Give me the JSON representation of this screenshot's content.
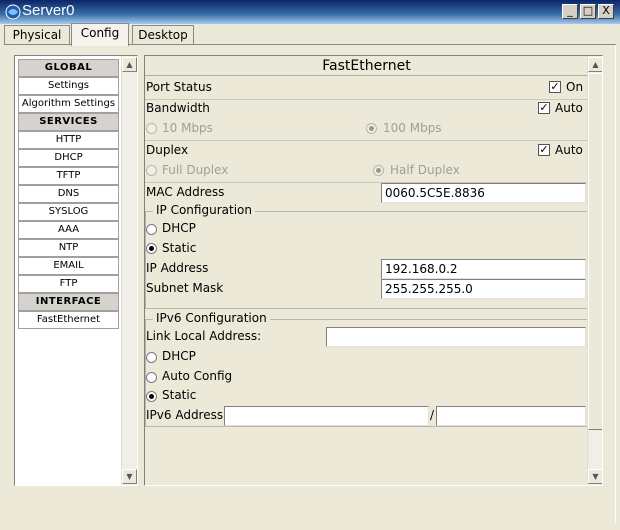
{
  "window": {
    "title": "Server0",
    "controls": {
      "minimize": "_",
      "maximize": "□",
      "close": "X"
    }
  },
  "tabs": [
    {
      "label": "Physical",
      "active": false
    },
    {
      "label": "Config",
      "active": true
    },
    {
      "label": "Desktop",
      "active": false
    }
  ],
  "sidebar": {
    "global_header": "GLOBAL",
    "global_items": [
      "Settings",
      "Algorithm Settings"
    ],
    "services_header": "SERVICES",
    "services_items": [
      "HTTP",
      "DHCP",
      "TFTP",
      "DNS",
      "SYSLOG",
      "AAA",
      "NTP",
      "EMAIL",
      "FTP"
    ],
    "interface_header": "INTERFACE",
    "interface_items": [
      "FastEthernet"
    ]
  },
  "panel": {
    "title": "FastEthernet",
    "port_status": {
      "label": "Port Status",
      "on_label": "On",
      "checked": true
    },
    "bandwidth": {
      "label": "Bandwidth",
      "auto_label": "Auto",
      "auto_checked": true,
      "options": [
        "10 Mbps",
        "100 Mbps"
      ],
      "selected": "100 Mbps"
    },
    "duplex": {
      "label": "Duplex",
      "auto_label": "Auto",
      "auto_checked": true,
      "options": [
        "Full Duplex",
        "Half Duplex"
      ],
      "selected": "Half Duplex"
    },
    "mac": {
      "label": "MAC Address",
      "value": "0060.5C5E.8836"
    },
    "ip_config": {
      "legend": "IP Configuration",
      "dhcp_label": "DHCP",
      "static_label": "Static",
      "selected": "Static",
      "ip_label": "IP Address",
      "ip_value": "192.168.0.2",
      "mask_label": "Subnet Mask",
      "mask_value": "255.255.255.0"
    },
    "ipv6_config": {
      "legend": "IPv6 Configuration",
      "link_local_label": "Link Local Address:",
      "link_local_value": "",
      "dhcp_label": "DHCP",
      "auto_label": "Auto Config",
      "static_label": "Static",
      "selected": "Static",
      "address_label": "IPv6 Address",
      "address_value": "",
      "separator": "/",
      "prefix_value": ""
    }
  },
  "colors": {
    "titlebar": "#0a246a",
    "window_bg": "#ece9d8"
  }
}
